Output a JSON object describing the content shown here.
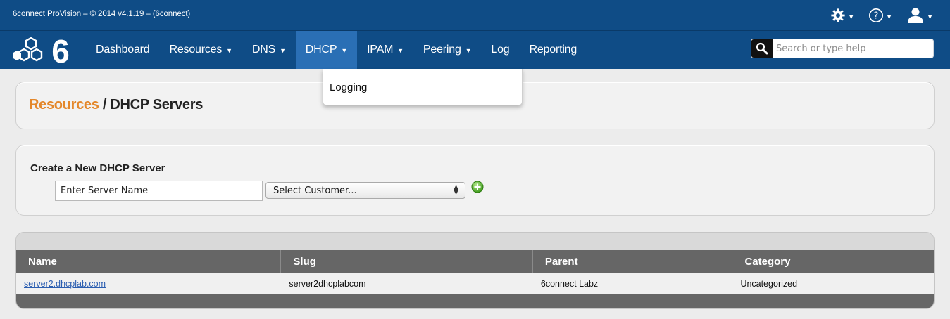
{
  "titlebar": {
    "text": "6connect ProVision – © 2014 v4.1.19 – (6connect)",
    "tools": [
      "gear-icon",
      "help-icon",
      "user-icon"
    ]
  },
  "brand": {
    "logo_text": "6"
  },
  "nav": {
    "items": [
      {
        "label": "Dashboard",
        "caret": ""
      },
      {
        "label": "Resources",
        "caret": "▼"
      },
      {
        "label": "DNS",
        "caret": "▼"
      },
      {
        "label": "DHCP",
        "caret": "▼",
        "active": true
      },
      {
        "label": "IPAM",
        "caret": "▼"
      },
      {
        "label": "Peering",
        "caret": "▼"
      },
      {
        "label": "Log",
        "caret": ""
      },
      {
        "label": "Reporting",
        "caret": ""
      }
    ],
    "dhcp_menu": [
      "Logging"
    ]
  },
  "search": {
    "placeholder": "Search or type help",
    "value": ""
  },
  "breadcrumb": {
    "parent": "Resources",
    "separator": " / ",
    "current": "DHCP Servers"
  },
  "create": {
    "heading": "Create a New DHCP Server",
    "server_name_value": "Enter Server Name",
    "customer_select": "Select Customer..."
  },
  "table": {
    "columns": [
      "Name",
      "Slug",
      "Parent",
      "Category"
    ],
    "rows": [
      [
        "server2.dhcplab.com",
        "server2dhcplabcom",
        "6connect Labz",
        "Uncategorized"
      ]
    ]
  },
  "colors": {
    "nav_bg": "#0f4c86",
    "nav_active": "#2a6fb5",
    "accent_orange": "#e4872a",
    "table_header": "#666666",
    "link": "#2a5db0"
  }
}
